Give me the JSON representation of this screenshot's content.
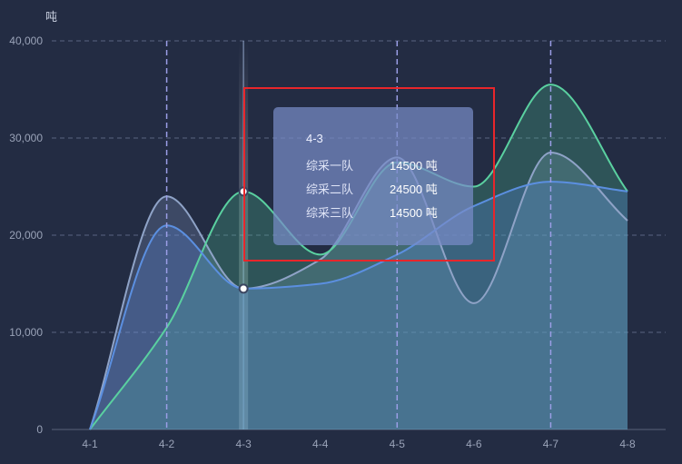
{
  "chart_data": {
    "type": "area",
    "ylabel": "吨",
    "categories": [
      "4-1",
      "4-2",
      "4-3",
      "4-4",
      "4-5",
      "4-6",
      "4-7",
      "4-8"
    ],
    "ylim": [
      0,
      40000
    ],
    "yticks": [
      0,
      10000,
      20000,
      30000,
      40000
    ],
    "ytick_labels": [
      "0",
      "10,000",
      "20,000",
      "30,000",
      "40,000"
    ],
    "grid": true,
    "series": [
      {
        "name": "综采一队",
        "color": "#8fa3c7",
        "values": [
          0,
          24000,
          14500,
          17500,
          28000,
          13000,
          28500,
          21500
        ]
      },
      {
        "name": "综采二队",
        "color": "#5ad0a0",
        "values": [
          0,
          10500,
          24500,
          18000,
          27500,
          25000,
          35500,
          24500
        ]
      },
      {
        "name": "综采三队",
        "color": "#5b8fe0",
        "values": [
          0,
          21000,
          14500,
          15000,
          18000,
          23000,
          25500,
          24500
        ]
      }
    ],
    "highlight_category": "4-3",
    "dashed_markers": [
      "4-2",
      "4-5",
      "4-7"
    ]
  },
  "tooltip": {
    "title": "4-3",
    "rows": [
      {
        "name": "综采一队",
        "value": "14500 吨"
      },
      {
        "name": "综采二队",
        "value": "24500 吨"
      },
      {
        "name": "综采三队",
        "value": "14500 吨"
      }
    ]
  }
}
